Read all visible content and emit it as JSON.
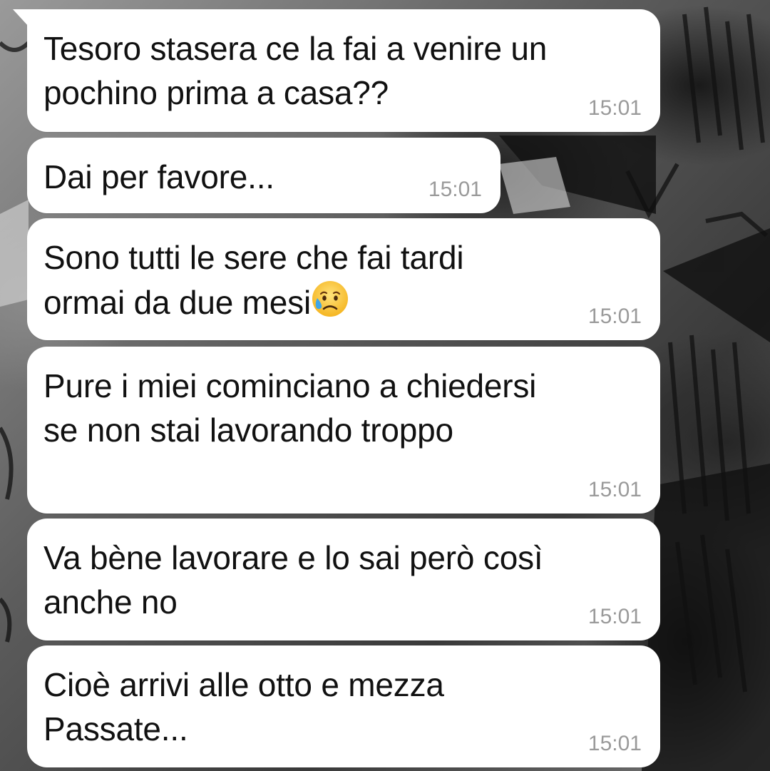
{
  "chat": {
    "messages": [
      {
        "text": "Tesoro stasera ce la fai a venire un\npochino prima a casa??",
        "time": "15:01"
      },
      {
        "text": "Dai per favore...",
        "time": "15:01"
      },
      {
        "text": "Sono tutti le sere che fai tardi\normai da due mesi",
        "emoji": "sad-relieved-face-emoji",
        "time": "15:01"
      },
      {
        "text": "Pure i miei cominciano a chiedersi\nse non stai lavorando troppo",
        "time": "15:01"
      },
      {
        "text": "Va bène lavorare e lo sai però così\nanche no",
        "time": "15:01"
      },
      {
        "text": "Cioè arrivi alle otto e mezza\nPassate...",
        "time": "15:01"
      }
    ]
  },
  "colors": {
    "bubble": "#ffffff",
    "text": "#111111",
    "timestamp": "#9a9a9a"
  }
}
